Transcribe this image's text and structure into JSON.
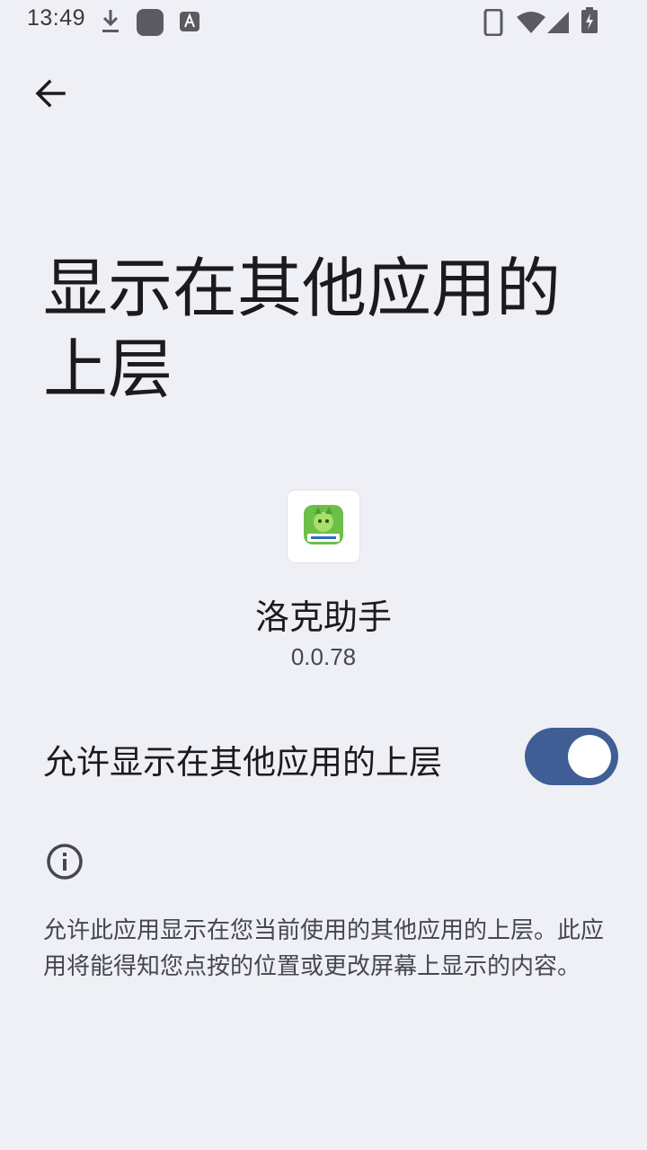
{
  "status_bar": {
    "time": "13:49",
    "icons": [
      "download-icon",
      "app-notification-icon",
      "text-a-icon",
      "phone-icon",
      "wifi-icon",
      "signal-icon",
      "battery-charging-icon"
    ]
  },
  "toolbar": {
    "back_icon": "arrow-back-icon"
  },
  "page": {
    "title": "显示在其他应用的上层"
  },
  "app": {
    "icon": "app-logo-icon",
    "name": "洛克助手",
    "version": "0.0.78"
  },
  "setting": {
    "label": "允许显示在其他应用的上层",
    "enabled": true,
    "accent_color": "#3f5e95"
  },
  "info": {
    "icon": "info-icon",
    "text": "允许此应用显示在您当前使用的其他应用的上层。此应用将能得知您点按的位置或更改屏幕上显示的内容。"
  },
  "colors": {
    "background": "#eff0f6",
    "primary_text": "#1b1b1f",
    "secondary_text": "#46464f"
  }
}
